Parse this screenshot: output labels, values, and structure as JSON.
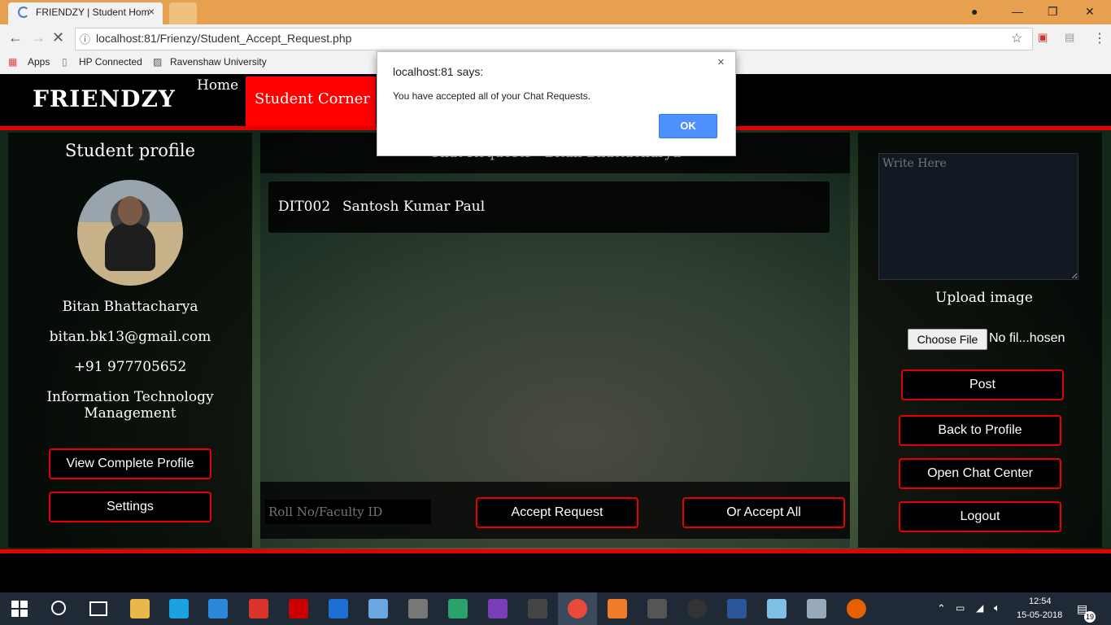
{
  "browser": {
    "tab_title": "FRIENDZY | Student Hom",
    "url": "localhost:81/Frienzy/Student_Accept_Request.php",
    "bookmarks": [
      "Apps",
      "HP Connected",
      "Ravenshaw University"
    ]
  },
  "nav": {
    "brand": "FRIENDZY",
    "home": "Home",
    "student_corner": "Student Corner"
  },
  "profile": {
    "title": "Student profile",
    "name": "Bitan Bhattacharya",
    "email": "bitan.bk13@gmail.com",
    "phone": "+91 977705652",
    "department_line1": "Information Technology",
    "department_line2": "Management",
    "view_profile_btn": "View Complete Profile",
    "settings_btn": "Settings"
  },
  "center": {
    "header": "Chat Requests - Bitan Bhattacharya",
    "requests": [
      {
        "id": "DIT002",
        "name": "Santosh Kumar Paul"
      }
    ],
    "roll_placeholder": "Roll No/Faculty ID",
    "accept_btn": "Accept Request",
    "accept_all_btn": "Or Accept All"
  },
  "right": {
    "post_placeholder": "Write Here",
    "upload_label": "Upload image",
    "choose_file": "Choose File",
    "file_status": "No fil...hosen",
    "post_btn": "Post",
    "back_btn": "Back to Profile",
    "chat_btn": "Open Chat Center",
    "logout_btn": "Logout"
  },
  "dialog": {
    "title": "localhost:81 says:",
    "message": "You have accepted all of your Chat Requests.",
    "ok": "OK",
    "close": "×"
  },
  "taskbar": {
    "time": "12:54",
    "date": "15-05-2018",
    "notifications": "19"
  },
  "colors": {
    "accent_red": "#e60000",
    "nav_active": "#ff0000",
    "dialog_ok": "#4d90fe"
  }
}
